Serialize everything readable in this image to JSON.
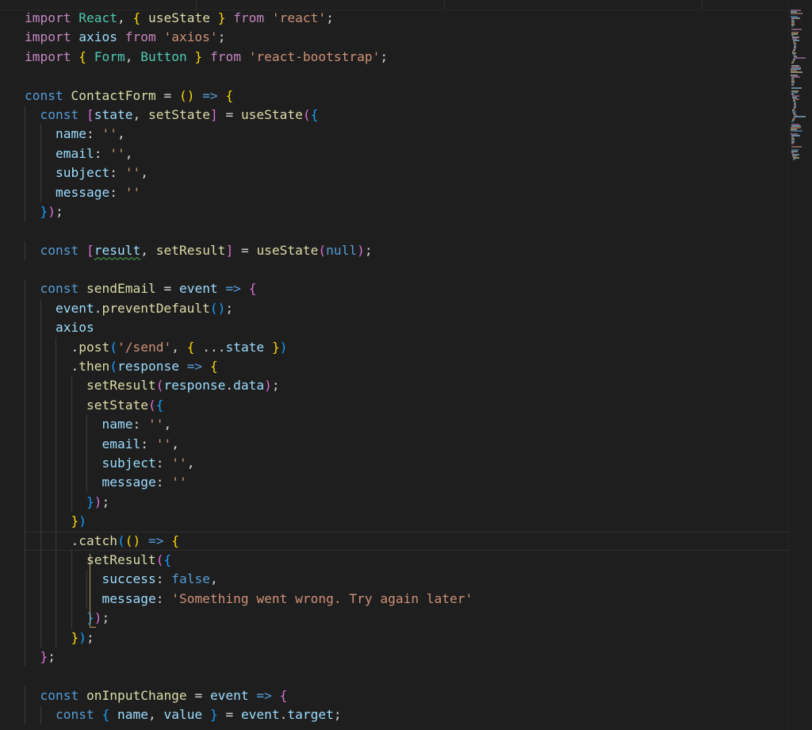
{
  "editor": {
    "language": "javascript",
    "theme_colors": {
      "background": "#1e1e1e",
      "keyword": "#c586c0",
      "string": "#ce9178",
      "declaration": "#569cd6",
      "variable": "#9cdcfe",
      "function": "#dcdcaa",
      "type": "#4ec9b0",
      "text": "#d4d4d4"
    },
    "lines": [
      "import React, { useState } from 'react';",
      "import axios from 'axios';",
      "import { Form, Button } from 'react-bootstrap';",
      "",
      "const ContactForm = () => {",
      "  const [state, setState] = useState({",
      "    name: '',",
      "    email: '',",
      "    subject: '',",
      "    message: ''",
      "  });",
      "",
      "  const [result, setResult] = useState(null);",
      "",
      "  const sendEmail = event => {",
      "    event.preventDefault();",
      "    axios",
      "      .post('/send', { ...state })",
      "      .then(response => {",
      "        setResult(response.data);",
      "        setState({",
      "          name: '',",
      "          email: '',",
      "          subject: '',",
      "          message: ''",
      "        });",
      "      })",
      "      .catch(() => {",
      "        setResult({",
      "          success: false,",
      "          message: 'Something went wrong. Try again later'",
      "        });",
      "      });",
      "  };",
      "",
      "  const onInputChange = event => {",
      "    const { name, value } = event.target;"
    ]
  }
}
